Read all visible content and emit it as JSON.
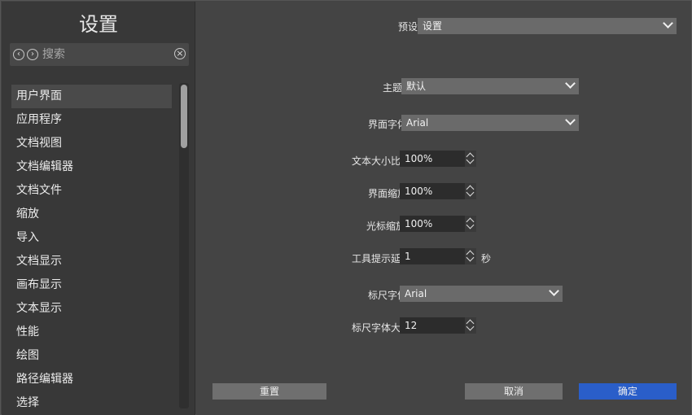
{
  "sidebar": {
    "title": "设置",
    "search_placeholder": "搜索",
    "items": [
      {
        "label": "用户界面"
      },
      {
        "label": "应用程序"
      },
      {
        "label": "文档视图"
      },
      {
        "label": "文档编辑器"
      },
      {
        "label": "文档文件"
      },
      {
        "label": "缩放"
      },
      {
        "label": "导入"
      },
      {
        "label": "文档显示"
      },
      {
        "label": "画布显示"
      },
      {
        "label": "文本显示"
      },
      {
        "label": "性能"
      },
      {
        "label": "绘图"
      },
      {
        "label": "路径编辑器"
      },
      {
        "label": "选择"
      }
    ]
  },
  "preset": {
    "label": "预设",
    "value": "设置"
  },
  "fields": {
    "theme": {
      "label": "主题",
      "value": "默认"
    },
    "ui_font": {
      "label": "界面字体",
      "value": "Arial"
    },
    "text_size": {
      "label": "文本大小比",
      "value": "100%"
    },
    "ui_scale": {
      "label": "界面缩放",
      "value": "100%"
    },
    "cursor_scale": {
      "label": "光标缩放",
      "value": "100%"
    },
    "tooltip_delay": {
      "label": "工具提示延",
      "value": "1",
      "unit": "秒"
    },
    "ruler_font": {
      "label": "标尺字体",
      "value": "Arial"
    },
    "ruler_font_size": {
      "label": "标尺字体大",
      "value": "12"
    }
  },
  "buttons": {
    "reset": "重置",
    "cancel": "取消",
    "ok": "确定"
  },
  "colors": {
    "accent": "#2a5ec9",
    "background": "#444444",
    "sidebar": "#383838"
  }
}
